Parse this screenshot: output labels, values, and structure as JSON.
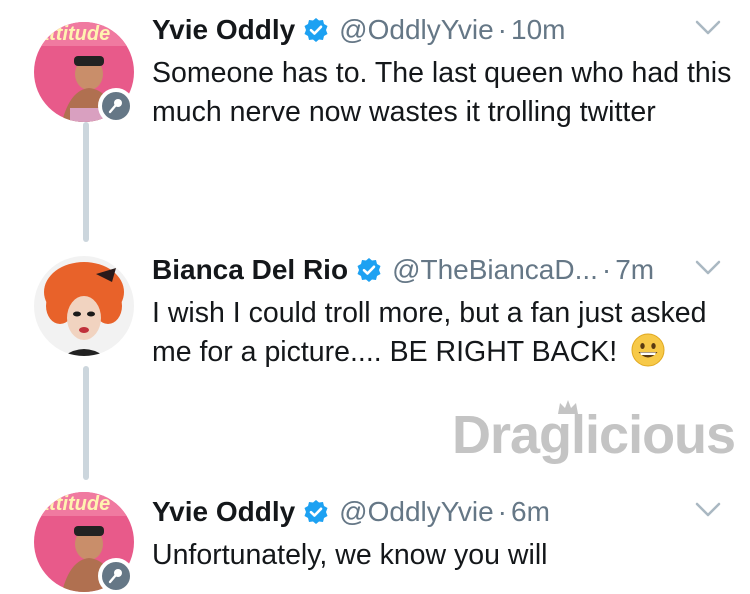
{
  "tweets": [
    {
      "name": "Yvie Oddly",
      "handle": "@OddlyYvie",
      "dot": "·",
      "time": "10m",
      "text": "Someone has to. The last queen who had this much nerve now wastes it trolling twitter",
      "avatar_label": "attitude"
    },
    {
      "name": "Bianca Del Rio",
      "handle": "@TheBiancaD...",
      "dot": "·",
      "time": "7m",
      "text": "I wish I could troll more, but  a fan just asked me for a picture.... BE RIGHT BACK!"
    },
    {
      "name": "Yvie Oddly",
      "handle": "@OddlyYvie",
      "dot": "·",
      "time": "6m",
      "text": "Unfortunately, we know you will",
      "avatar_label": "attitude"
    }
  ],
  "watermark": {
    "text": "Draglicious"
  },
  "icons": {
    "verified": "verified-badge-icon",
    "caret": "chevron-down-icon",
    "mic": "microphone-icon",
    "emoji": "grinning-face-emoji"
  },
  "colors": {
    "verified_blue": "#1da1f2",
    "secondary_text": "#657786",
    "thread_line": "#ccd6dd"
  }
}
